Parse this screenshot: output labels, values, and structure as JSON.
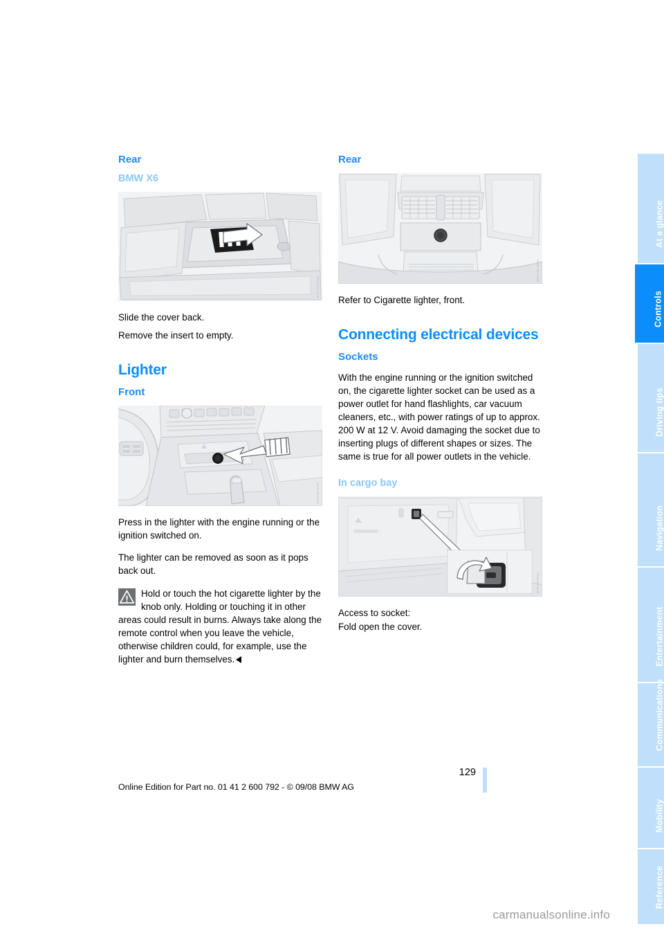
{
  "document": {
    "page_number": "129",
    "edition_line": "Online Edition for Part no. 01 41 2 600 792 - © 09/08 BMW AG",
    "site_watermark": "carmanualsonline.info"
  },
  "colors": {
    "accent_blue": "#0b8dfa",
    "section_blue": "#1a8cf5",
    "sub_blue": "#8cc7f5",
    "tab_inactive": "#bfdffb",
    "tab_active": "#0b8dfa",
    "figure_bg": "#f3f4f5",
    "warn_icon_bg": "#6d6e70"
  },
  "tabs": [
    {
      "label": "At a glance",
      "active": false
    },
    {
      "label": "Controls",
      "active": true
    },
    {
      "label": "Driving tips",
      "active": false
    },
    {
      "label": "Navigation",
      "active": false
    },
    {
      "label": "Entertainment",
      "active": false
    },
    {
      "label": "Communications",
      "active": false
    },
    {
      "label": "Mobility",
      "active": false
    },
    {
      "label": "Reference",
      "active": false
    }
  ],
  "left_column": {
    "heading_rear": "Rear",
    "subheading_model": "BMW X6",
    "figure_rear_seat_watermark": "WX0-04-0545",
    "para_slide": "Slide the cover back.",
    "para_remove": "Remove the insert to empty.",
    "heading_lighter": "Lighter",
    "subheading_front": "Front",
    "figure_front_console_watermark": "WX0-02-0040",
    "para_press": "Press in the lighter with the engine running or the ignition switched on.",
    "para_pops": "The lighter can be removed as soon as it pops back out.",
    "warning_icon": "warning-triangle-icon",
    "warning_text": "Hold or touch the hot cigarette lighter by the knob only. Holding or touching it in other areas could result in burns. Always take along the remote control when you leave the vehicle, otherwise children could, for example, use the lighter and burn themselves."
  },
  "right_column": {
    "heading_rear": "Rear",
    "figure_rear_console_watermark": "WX0-05-0040",
    "para_refer": "Refer to Cigarette lighter, front.",
    "heading_connecting": "Connecting electrical devices",
    "subheading_sockets": "Sockets",
    "para_sockets": "With the engine running or the ignition switched on, the cigarette lighter socket can be used as a power outlet for hand flashlights, car vacuum cleaners, etc., with power ratings of up to approx. 200 W at 12 V. Avoid damaging the socket due to inserting plugs of different shapes or sizes. The same is true for all power outlets in the vehicle.",
    "subheading_cargo": "In cargo bay",
    "figure_cargo_watermark": "WX0-05-0041",
    "para_access": "Access to socket:",
    "para_fold": "Fold open the cover."
  }
}
